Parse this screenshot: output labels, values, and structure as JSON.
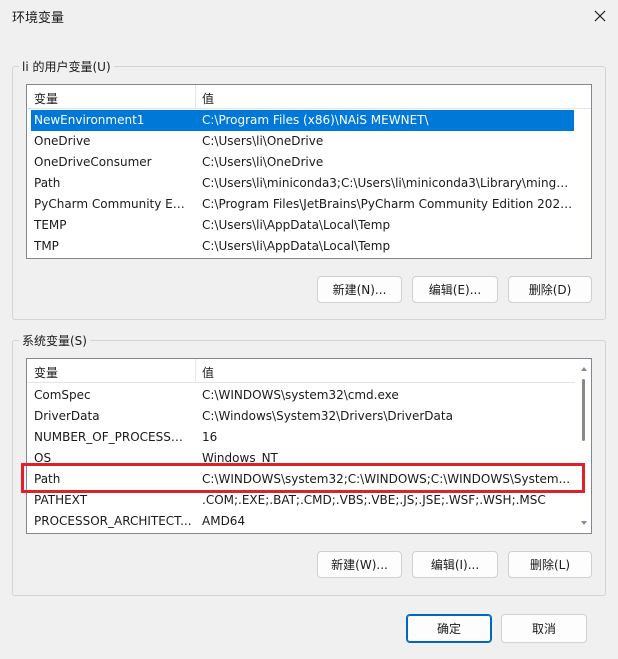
{
  "window": {
    "title": "环境变量"
  },
  "user_vars": {
    "group_label": "li 的用户变量(U)",
    "columns": [
      "变量",
      "值"
    ],
    "rows": [
      {
        "name": "NewEnvironment1",
        "value": "C:\\Program Files (x86)\\NAiS MEWNET\\",
        "selected": true
      },
      {
        "name": "OneDrive",
        "value": "C:\\Users\\li\\OneDrive"
      },
      {
        "name": "OneDriveConsumer",
        "value": "C:\\Users\\li\\OneDrive"
      },
      {
        "name": "Path",
        "value": "C:\\Users\\li\\miniconda3;C:\\Users\\li\\miniconda3\\Library\\mingw..."
      },
      {
        "name": "PyCharm Community Editi...",
        "value": "C:\\Program Files\\JetBrains\\PyCharm Community Edition 2024...."
      },
      {
        "name": "TEMP",
        "value": "C:\\Users\\li\\AppData\\Local\\Temp"
      },
      {
        "name": "TMP",
        "value": "C:\\Users\\li\\AppData\\Local\\Temp"
      }
    ],
    "buttons": {
      "new": "新建(N)...",
      "edit": "编辑(E)...",
      "delete": "删除(D)"
    }
  },
  "system_vars": {
    "group_label": "系统变量(S)",
    "columns": [
      "变量",
      "值"
    ],
    "rows": [
      {
        "name": "ComSpec",
        "value": "C:\\WINDOWS\\system32\\cmd.exe"
      },
      {
        "name": "DriverData",
        "value": "C:\\Windows\\System32\\Drivers\\DriverData"
      },
      {
        "name": "NUMBER_OF_PROCESSORS",
        "value": "16"
      },
      {
        "name": "OS",
        "value": "Windows_NT"
      },
      {
        "name": "Path",
        "value": "C:\\WINDOWS\\system32;C:\\WINDOWS;C:\\WINDOWS\\System...",
        "highlighted": true
      },
      {
        "name": "PATHEXT",
        "value": ".COM;.EXE;.BAT;.CMD;.VBS;.VBE;.JS;.JSE;.WSF;.WSH;.MSC"
      },
      {
        "name": "PROCESSOR_ARCHITECT...",
        "value": "AMD64"
      }
    ],
    "buttons": {
      "new": "新建(W)...",
      "edit": "编辑(I)...",
      "delete": "删除(L)"
    }
  },
  "footer": {
    "ok": "确定",
    "cancel": "取消"
  },
  "colors": {
    "selection": "#0078d7",
    "highlight_annotation": "#e0202a",
    "primary_border": "#0067c0"
  },
  "icons": {
    "close": "close-icon",
    "scroll_up": "chevron-up-icon",
    "scroll_down": "chevron-down-icon"
  }
}
